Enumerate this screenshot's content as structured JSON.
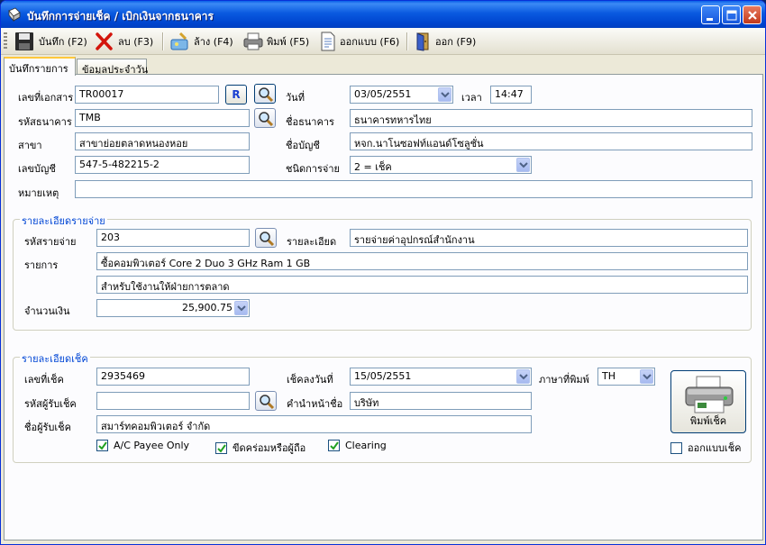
{
  "window": {
    "title": "บันทึกการจ่ายเช็ค / เบิกเงินจากธนาคาร"
  },
  "toolbar": {
    "save": "บันทึก (F2)",
    "delete": "ลบ (F3)",
    "clear": "ล้าง (F4)",
    "print": "พิมพ์ (F5)",
    "design": "ออกแบบ (F6)",
    "exit": "ออก (F9)"
  },
  "tabs": [
    "บันทึกรายการ",
    "ข้อมูลประจำวัน"
  ],
  "header": {
    "doc_no_label": "เลขที่เอกสาร",
    "doc_no": "TR00017",
    "r_button": "R",
    "date_label": "วันที่",
    "date": "03/05/2551",
    "time_label": "เวลา",
    "time": "14:47",
    "bank_code_label": "รหัสธนาคาร",
    "bank_code": "TMB",
    "bank_name_label": "ชื่อธนาคาร",
    "bank_name": "ธนาคารทหารไทย",
    "branch_label": "สาขา",
    "branch": "สาขาย่อยตลาดหนองหอย",
    "account_name_label": "ชื่อบัญชี",
    "account_name": "หจก.นาโนซอฟท์แอนด์โซลูชั่น",
    "account_no_label": "เลขบัญชี",
    "account_no": "547-5-482215-2",
    "pay_type_label": "ชนิดการจ่าย",
    "pay_type": "2 = เช็ค",
    "note_label": "หมายเหตุ",
    "note": ""
  },
  "expense": {
    "title": "รายละเอียดรายจ่าย",
    "code_label": "รหัสรายจ่าย",
    "code": "203",
    "detail_label": "รายละเอียด",
    "detail": "รายจ่ายค่าอุปกรณ์สำนักงาน",
    "item_label": "รายการ",
    "item_line1": "ซื้อคอมพิวเตอร์ Core 2 Duo  3 GHz  Ram 1 GB",
    "item_line2": "สำหรับใช้งานให้ฝ่ายการตลาด",
    "amount_label": "จำนวนเงิน",
    "amount": "25,900.75"
  },
  "cheque": {
    "title": "รายละเอียดเช็ค",
    "no_label": "เลขที่เช็ค",
    "no": "2935469",
    "date_label": "เช็คลงวันที่",
    "date": "15/05/2551",
    "lang_label": "ภาษาที่พิมพ์",
    "lang": "TH",
    "payee_code_label": "รหัสผู้รับเช็ค",
    "payee_code": "",
    "prefix_label": "คำนำหน้าชื่อ",
    "prefix": "บริษัท",
    "payee_name_label": "ชื่อผู้รับเช็ค",
    "payee_name": "สมาร์ทคอมพิวเตอร์ จำกัด",
    "ac_payee": "A/C Payee Only",
    "ac_payee_checked": true,
    "strike_bearer": "ขีดคร่อมหรือผู้ถือ",
    "strike_bearer_checked": true,
    "clearing": "Clearing",
    "clearing_checked": true,
    "print_cheque": "พิมพ์เช็ค",
    "design_cheque": "ออกแบบเช็ค",
    "design_cheque_checked": false
  },
  "colors": {
    "accent": "#0046d5",
    "titlebar": "#0054e3",
    "panel": "#fcfcfe",
    "border": "#7f9db9"
  }
}
